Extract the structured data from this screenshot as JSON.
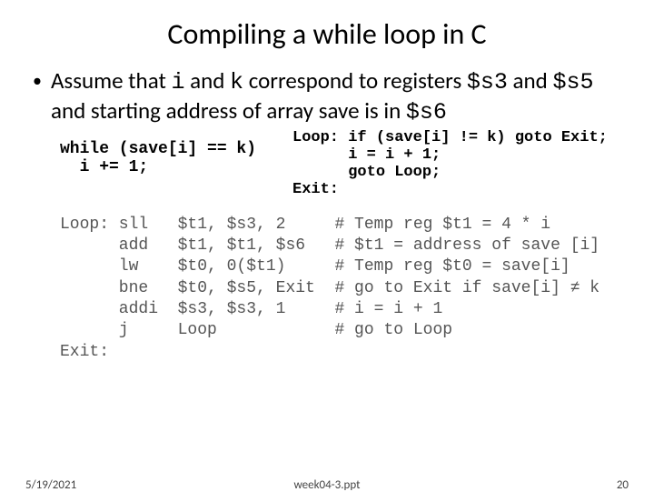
{
  "title": "Compiling a while loop in C",
  "bullet": {
    "lead": "Assume that ",
    "i_code": "i",
    "and1": " and ",
    "k_code": "k",
    "mid1": " correspond to registers ",
    "s3": "$s3",
    "and2": " and ",
    "s5": "$s5",
    "mid2": " and starting address of array save is in ",
    "s6": "$s6"
  },
  "c_code": "while (save[i] == k)\n  i += 1;",
  "goto_code": "Loop: if (save[i] != k) goto Exit;\n      i = i + 1;\n      goto Loop;\nExit:",
  "asm": "Loop: sll   $t1, $s3, 2     # Temp reg $t1 = 4 * i\n      add   $t1, $t1, $s6   # $t1 = address of save [i]\n      lw    $t0, 0($t1)     # Temp reg $t0 = save[i]\n      bne   $t0, $s5, Exit  # go to Exit if save[i] ≠ k\n      addi  $s3, $s3, 1     # i = i + 1\n      j     Loop            # go to Loop\nExit:",
  "footer": {
    "date": "5/19/2021",
    "file": "week04-3.ppt",
    "page": "20"
  }
}
